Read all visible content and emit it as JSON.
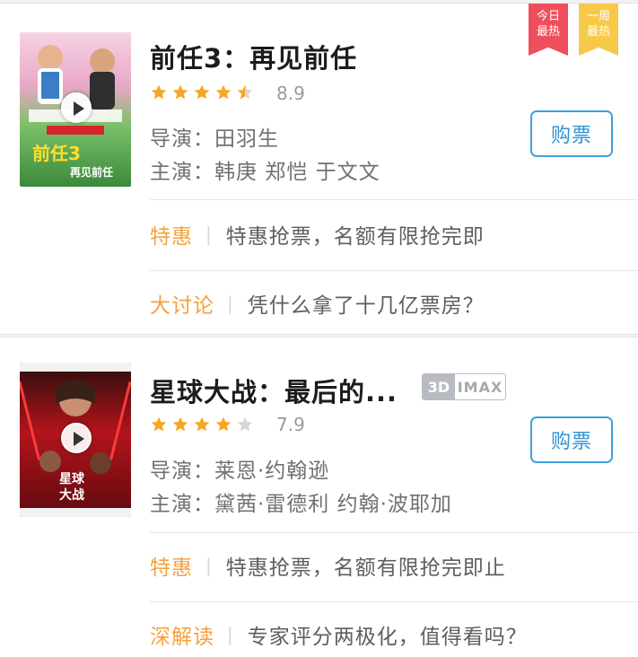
{
  "colors": {
    "accent_blue": "#3ea0dd",
    "star_orange": "#f5a623",
    "star_empty": "#d6d6d6",
    "tag_orange": "#f3a23d",
    "ribbon_red": "#ef4f5c",
    "ribbon_yellow": "#f7c948"
  },
  "movies": [
    {
      "title": "前任3：再见前任",
      "rating_stars": 4.5,
      "score": "8.9",
      "director": "导演：田羽生",
      "cast": "主演：韩庚 郑恺 于文文",
      "buy_label": "购票",
      "poster_icon": "movie-poster-image",
      "ribbons": [
        {
          "line1": "今日",
          "line2": "最热"
        },
        {
          "line1": "一周",
          "line2": "最热"
        }
      ],
      "promos": [
        {
          "tag": "特惠",
          "text": "特惠抢票，名额有限抢完即"
        },
        {
          "tag": "大讨论",
          "text": "凭什么拿了十几亿票房？"
        }
      ]
    },
    {
      "title": "星球大战：最后的...",
      "badge_3d": "3D",
      "badge_imax": "IMAX",
      "rating_stars": 4,
      "score": "7.9",
      "director": "导演：莱恩·约翰逊",
      "cast": "主演：黛茜·雷德利 约翰·波耶加",
      "buy_label": "购票",
      "poster_icon": "movie-poster-image",
      "promos": [
        {
          "tag": "特惠",
          "text": "特惠抢票，名额有限抢完即止"
        },
        {
          "tag": "深解读",
          "text": "专家评分两极化，值得看吗？"
        }
      ]
    }
  ]
}
